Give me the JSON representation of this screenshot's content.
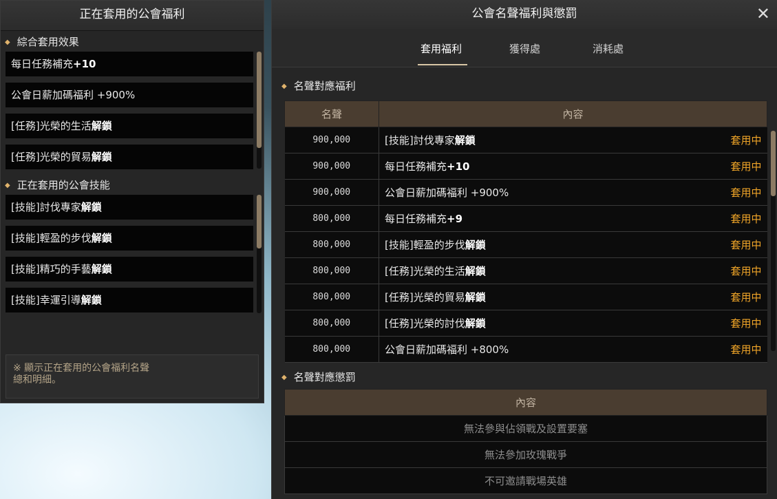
{
  "left": {
    "title": "正在套用的公會福利",
    "sections": [
      {
        "heading": "綜合套用效果",
        "items": [
          {
            "text": "每日任務補充",
            "bold": "+10"
          },
          {
            "text": "公會日薪加碼福利 +900%",
            "bold": ""
          },
          {
            "text": "[任務]光榮的生活",
            "bold": "解鎖"
          },
          {
            "text": "[任務]光榮的貿易",
            "bold": "解鎖"
          }
        ]
      },
      {
        "heading": "正在套用的公會技能",
        "items": [
          {
            "text": "[技能]討伐專家",
            "bold": "解鎖"
          },
          {
            "text": "[技能]輕盈的步伐",
            "bold": "解鎖"
          },
          {
            "text": "[技能]精巧的手藝",
            "bold": "解鎖"
          },
          {
            "text": "[技能]幸運引導",
            "bold": "解鎖"
          }
        ]
      }
    ],
    "note": "※ 顯示正在套用的公會福利名聲\n總和明細。"
  },
  "right": {
    "title": "公會名聲福利與懲罰",
    "tabs": [
      "套用福利",
      "獲得處",
      "消耗處"
    ],
    "active_tab": "套用福利",
    "benefits_heading": "名聲對應福利",
    "benefit_columns": [
      "名聲",
      "內容"
    ],
    "benefits": [
      {
        "rep": "900,000",
        "text": "[技能]討伐專家",
        "bold": "解鎖",
        "status": "套用中"
      },
      {
        "rep": "900,000",
        "text": "每日任務補充",
        "bold": "+10",
        "status": "套用中"
      },
      {
        "rep": "900,000",
        "text": "公會日薪加碼福利 +900%",
        "bold": "",
        "status": "套用中"
      },
      {
        "rep": "800,000",
        "text": "每日任務補充",
        "bold": "+9",
        "status": "套用中"
      },
      {
        "rep": "800,000",
        "text": "[技能]輕盈的步伐",
        "bold": "解鎖",
        "status": "套用中"
      },
      {
        "rep": "800,000",
        "text": "[任務]光榮的生活",
        "bold": "解鎖",
        "status": "套用中"
      },
      {
        "rep": "800,000",
        "text": "[任務]光榮的貿易",
        "bold": "解鎖",
        "status": "套用中"
      },
      {
        "rep": "800,000",
        "text": "[任務]光榮的討伐",
        "bold": "解鎖",
        "status": "套用中"
      },
      {
        "rep": "800,000",
        "text": "公會日薪加碼福利 +800%",
        "bold": "",
        "status": "套用中"
      }
    ],
    "penalties_heading": "名聲對應懲罰",
    "penalty_column": "內容",
    "penalties": [
      "無法參與佔領戰及設置要塞",
      "無法參加玫瑰戰爭",
      "不可邀請戰場英雄"
    ]
  },
  "icons": {
    "close": "close-icon",
    "bullet": "diamond-bullet-icon"
  }
}
